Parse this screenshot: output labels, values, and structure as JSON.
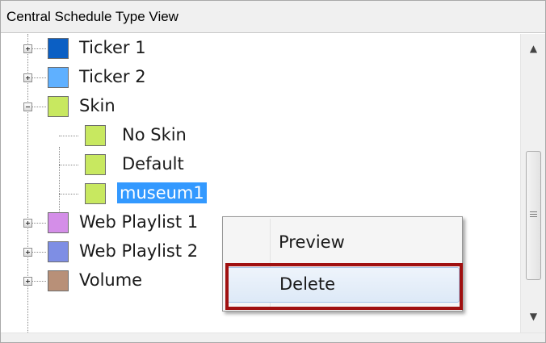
{
  "header": {
    "title": "Central Schedule Type View"
  },
  "tree": {
    "items": [
      {
        "label": "Ticker 1",
        "color": "#0b5fc4",
        "expander": "plus"
      },
      {
        "label": "Ticker 2",
        "color": "#5fb0ff",
        "expander": "plus"
      },
      {
        "label": "Skin",
        "color": "#c8e860",
        "expander": "minus"
      },
      {
        "label": "No Skin",
        "color": "#c8e860",
        "expander": "none"
      },
      {
        "label": "Default",
        "color": "#c8e860",
        "expander": "none"
      },
      {
        "label": "museum1",
        "color": "#c8e860",
        "expander": "none",
        "selected": true
      },
      {
        "label": "Web Playlist 1",
        "color": "#d48ee8",
        "expander": "plus"
      },
      {
        "label": "Web Playlist 2",
        "color": "#7e8ee4",
        "expander": "plus"
      },
      {
        "label": "Volume",
        "color": "#b89078",
        "expander": "plus"
      }
    ]
  },
  "context_menu": {
    "items": [
      {
        "label": "Preview"
      },
      {
        "label": "Delete"
      }
    ],
    "highlighted": "Delete"
  },
  "scrollbar": {
    "up_icon": "chevron-up-icon",
    "down_icon": "chevron-down-icon"
  }
}
